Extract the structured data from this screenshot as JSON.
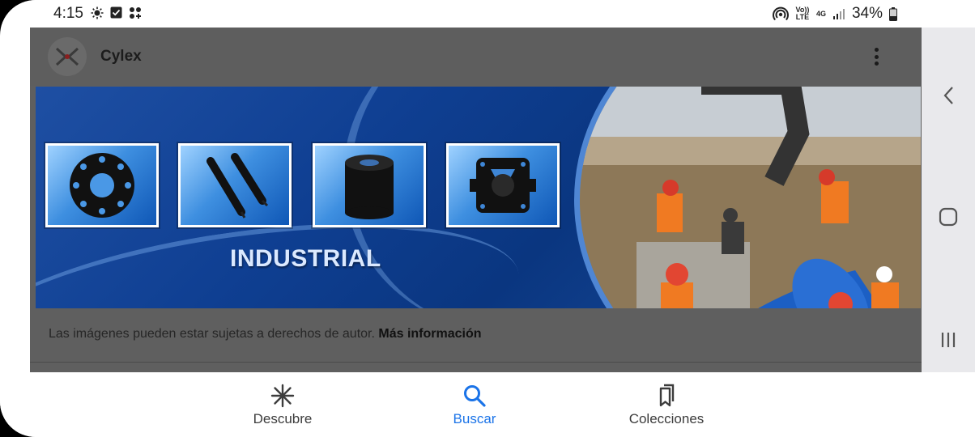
{
  "status_bar": {
    "time": "4:15",
    "left_icons": [
      "brightness-icon",
      "checkbox-icon",
      "apps-grid-icon"
    ],
    "volte_label": "Vo)) LTE",
    "network_label": "4G",
    "battery_percent": "34%"
  },
  "app": {
    "title": "Cylex",
    "logo_icon": "cylex-logo-icon"
  },
  "banner": {
    "caption": "INDUSTRIAL",
    "thumbnails": [
      "rubber-flange-gasket",
      "rubber-rods",
      "rubber-cylinder-block",
      "rubber-square-flange"
    ],
    "photo": "workers-installing-blue-pipe"
  },
  "notice": {
    "text": "Las imágenes pueden estar sujetas a derechos de autor. ",
    "link": "Más información"
  },
  "bottom_nav": {
    "items": [
      {
        "label": "Descubre",
        "icon": "asterisk-icon",
        "active": false
      },
      {
        "label": "Buscar",
        "icon": "search-icon",
        "active": true
      },
      {
        "label": "Colecciones",
        "icon": "bookmarks-icon",
        "active": false
      }
    ]
  },
  "system_nav": {
    "buttons": [
      "back-icon",
      "home-icon",
      "recents-icon"
    ]
  },
  "colors": {
    "accent": "#1a73e8",
    "overlay": "#5f5f5f",
    "banner_blue": "#0f3f92"
  }
}
